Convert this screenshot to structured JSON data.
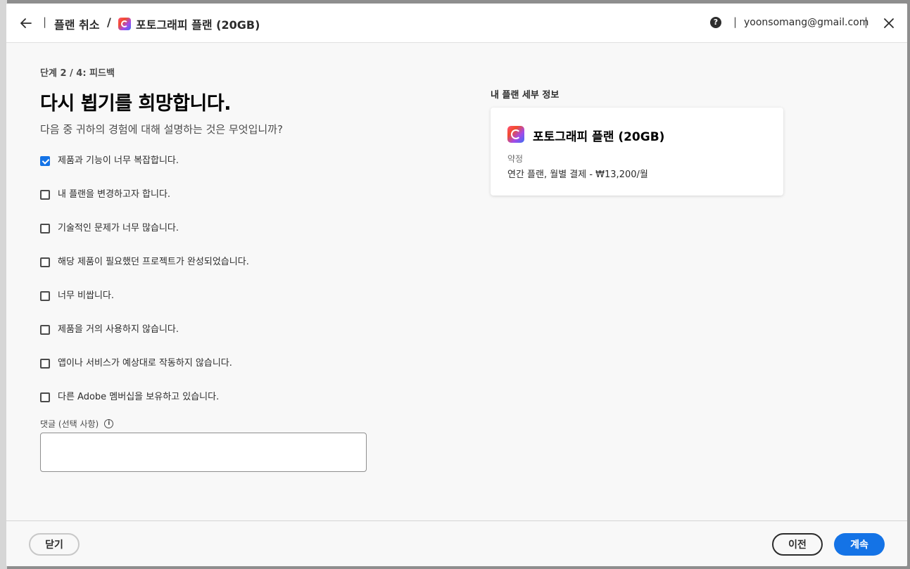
{
  "header": {
    "breadcrumb_cancel": "플랜 취소",
    "breadcrumb_plan": "포토그래피 플랜 (20GB)",
    "separator_1": "|",
    "separator_2": "/",
    "separator_3": "|",
    "separator_4": "|",
    "email": "yoonsomang@gmail.com",
    "help_glyph": "?"
  },
  "main": {
    "step": "단계 2 / 4: 피드백",
    "title": "다시 뵙기를 희망합니다.",
    "subtitle": "다음 중 귀하의 경험에 대해 설명하는 것은 무엇입니까?",
    "options": [
      {
        "label": "제품과 기능이 너무 복잡합니다.",
        "checked": true
      },
      {
        "label": "내 플랜을 변경하고자 합니다.",
        "checked": false
      },
      {
        "label": "기술적인 문제가 너무 많습니다.",
        "checked": false
      },
      {
        "label": "해당 제품이 필요했던 프로젝트가 완성되었습니다.",
        "checked": false
      },
      {
        "label": "너무 비쌉니다.",
        "checked": false
      },
      {
        "label": "제품을 거의 사용하지 않습니다.",
        "checked": false
      },
      {
        "label": "앱이나 서비스가 예상대로 작동하지 않습니다.",
        "checked": false
      },
      {
        "label": "다른 Adobe 멤버십을 보유하고 있습니다.",
        "checked": false
      }
    ],
    "comment_label": "댓글 (선택 사항)",
    "comment_value": "",
    "info_glyph": "i"
  },
  "plan": {
    "heading": "내 플랜 세부 정보",
    "name": "포토그래피 플랜 (20GB)",
    "term_label": "약정",
    "term_value": "연간 플랜, 월별 결제 - ₩13,200/월"
  },
  "footer": {
    "close_label": "닫기",
    "prev_label": "이전",
    "next_label": "계속"
  },
  "colors": {
    "accent": "#1473e6",
    "overlay": "#8e8e8e"
  }
}
